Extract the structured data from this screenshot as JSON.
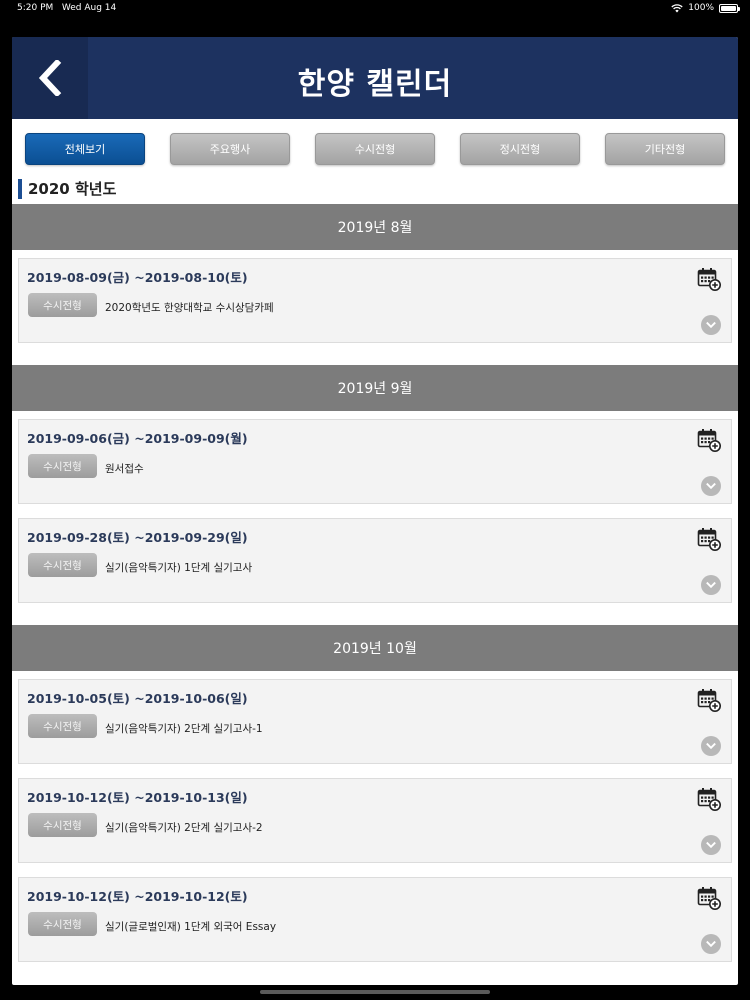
{
  "status_bar": {
    "time": "5:20 PM",
    "date": "Wed Aug 14",
    "battery": "100%",
    "battery_level": 1.0,
    "wifi_icon": "wifi-icon"
  },
  "header": {
    "title": "한양 캘린더",
    "back_icon": "chevron-left-icon",
    "background": "#1d3260"
  },
  "tabs": [
    {
      "label": "전체보기",
      "active": true
    },
    {
      "label": "주요행사",
      "active": false
    },
    {
      "label": "수시전형",
      "active": false
    },
    {
      "label": "정시전형",
      "active": false
    },
    {
      "label": "기타전형",
      "active": false
    }
  ],
  "section": {
    "year_title": "2020 학년도"
  },
  "months": [
    {
      "label": "2019년 8월",
      "events": [
        {
          "date": "2019-08-09(금) ~2019-08-10(토)",
          "badge": "수시전형",
          "title": "2020학년도 한양대학교 수시상담카페"
        }
      ]
    },
    {
      "label": "2019년 9월",
      "events": [
        {
          "date": "2019-09-06(금) ~2019-09-09(월)",
          "badge": "수시전형",
          "title": "원서접수"
        },
        {
          "date": "2019-09-28(토) ~2019-09-29(일)",
          "badge": "수시전형",
          "title": "실기(음악특기자) 1단계 실기고사"
        }
      ]
    },
    {
      "label": "2019년 10월",
      "events": [
        {
          "date": "2019-10-05(토) ~2019-10-06(일)",
          "badge": "수시전형",
          "title": "실기(음악특기자) 2단계 실기고사-1"
        },
        {
          "date": "2019-10-12(토) ~2019-10-13(일)",
          "badge": "수시전형",
          "title": "실기(음악특기자) 2단계 실기고사-2"
        },
        {
          "date": "2019-10-12(토) ~2019-10-12(토)",
          "badge": "수시전형",
          "title": "실기(글로벌인재) 1단계 외국어 Essay"
        }
      ]
    }
  ],
  "icons": {
    "calendar_add": "calendar-add-icon",
    "expand": "chevron-down-icon"
  },
  "colors": {
    "accent": "#0b4f93",
    "month_bar": "#7c7c7c",
    "card_bg": "#f3f3f3"
  }
}
